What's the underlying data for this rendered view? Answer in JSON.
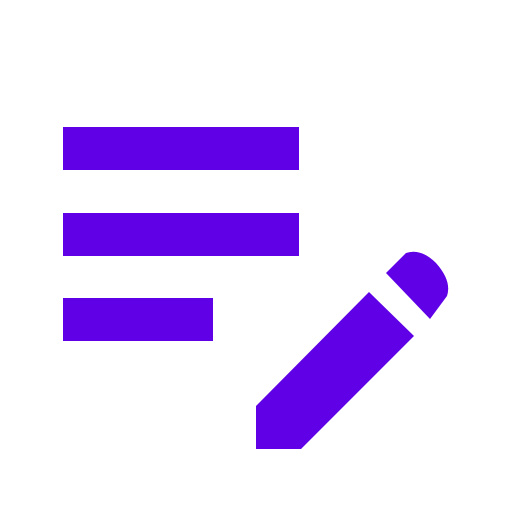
{
  "icon": {
    "name": "edit-note-icon",
    "color": "#5f00e6",
    "background": "#ffffff"
  }
}
